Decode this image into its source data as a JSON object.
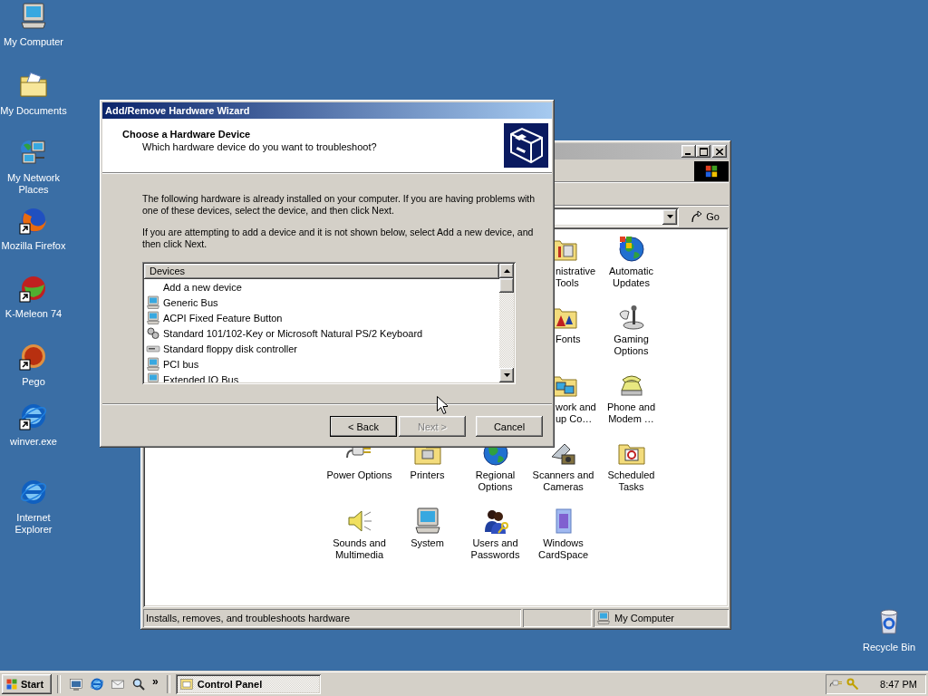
{
  "desktop_icons": [
    {
      "label": "My Computer",
      "kind": "computer",
      "shortcut": false
    },
    {
      "label": "My Documents",
      "kind": "documents",
      "shortcut": false
    },
    {
      "label": "My Network Places",
      "kind": "network",
      "shortcut": false
    },
    {
      "label": "Mozilla Firefox",
      "kind": "firefox",
      "shortcut": true
    },
    {
      "label": "K-Meleon 74",
      "kind": "kmeleon",
      "shortcut": true
    },
    {
      "label": "Pego",
      "kind": "pego",
      "shortcut": true
    },
    {
      "label": "winver.exe",
      "kind": "ie",
      "shortcut": true
    },
    {
      "label": "Internet Explorer",
      "kind": "ie",
      "shortcut": false
    }
  ],
  "recycle_bin": {
    "label": "Recycle Bin"
  },
  "control_panel": {
    "go": "Go",
    "icons_right": [
      {
        "label": "nistrative Tools",
        "kind": "admin",
        "clipped": true
      },
      {
        "label": "Automatic Updates",
        "kind": "updates",
        "clipped": false
      },
      {
        "label": "Fonts",
        "kind": "fonts",
        "clipped": true
      },
      {
        "label": "Gaming Options",
        "kind": "gaming",
        "clipped": false
      },
      {
        "label": "work and up Co…",
        "kind": "dialup",
        "clipped": true
      },
      {
        "label": "Phone and Modem …",
        "kind": "phone",
        "clipped": false
      }
    ],
    "icons": [
      {
        "label": "Power Options",
        "kind": "power"
      },
      {
        "label": "Printers",
        "kind": "printers"
      },
      {
        "label": "Regional Options",
        "kind": "regional"
      },
      {
        "label": "Scanners and Cameras",
        "kind": "scanner"
      },
      {
        "label": "Scheduled Tasks",
        "kind": "scheduled"
      },
      {
        "label": "Sounds and Multimedia",
        "kind": "sound"
      },
      {
        "label": "System",
        "kind": "system"
      },
      {
        "label": "Users and Passwords",
        "kind": "users"
      },
      {
        "label": "Windows CardSpace",
        "kind": "cardspace"
      }
    ],
    "status_text": "Installs, removes, and troubleshoots hardware",
    "status_zone": "My Computer"
  },
  "wizard": {
    "title": "Add/Remove Hardware Wizard",
    "heading": "Choose a Hardware Device",
    "subheading": "Which hardware device do you want to troubleshoot?",
    "paragraphs": [
      "The following hardware is already installed on your computer. If you are having problems with one of these devices, select the device, and then click Next.",
      "If you are attempting to add a device and it is not shown below, select Add a new device, and then click Next."
    ],
    "list_column": "Devices",
    "devices": [
      {
        "label": "Add a new device",
        "kind": "none",
        "selected": false
      },
      {
        "label": "Generic Bus",
        "kind": "computer",
        "selected": false
      },
      {
        "label": "ACPI Fixed Feature Button",
        "kind": "computer",
        "selected": false
      },
      {
        "label": "Standard 101/102-Key or Microsoft Natural PS/2 Keyboard",
        "kind": "keyboard",
        "selected": false
      },
      {
        "label": "Standard floppy disk controller",
        "kind": "floppy",
        "selected": false
      },
      {
        "label": "PCI bus",
        "kind": "computer",
        "selected": false
      },
      {
        "label": "Extended IO Bus",
        "kind": "computer",
        "selected": false
      }
    ],
    "buttons": [
      {
        "label": "< Back",
        "disabled": false,
        "default": true
      },
      {
        "label": "Next >",
        "disabled": true,
        "default": false
      },
      {
        "label": "Cancel",
        "disabled": false,
        "default": false
      }
    ]
  },
  "taskbar": {
    "start": "Start",
    "more": "»",
    "tasks": [
      {
        "label": "Control Panel",
        "selected": true
      }
    ],
    "clock": "8:47 PM"
  }
}
